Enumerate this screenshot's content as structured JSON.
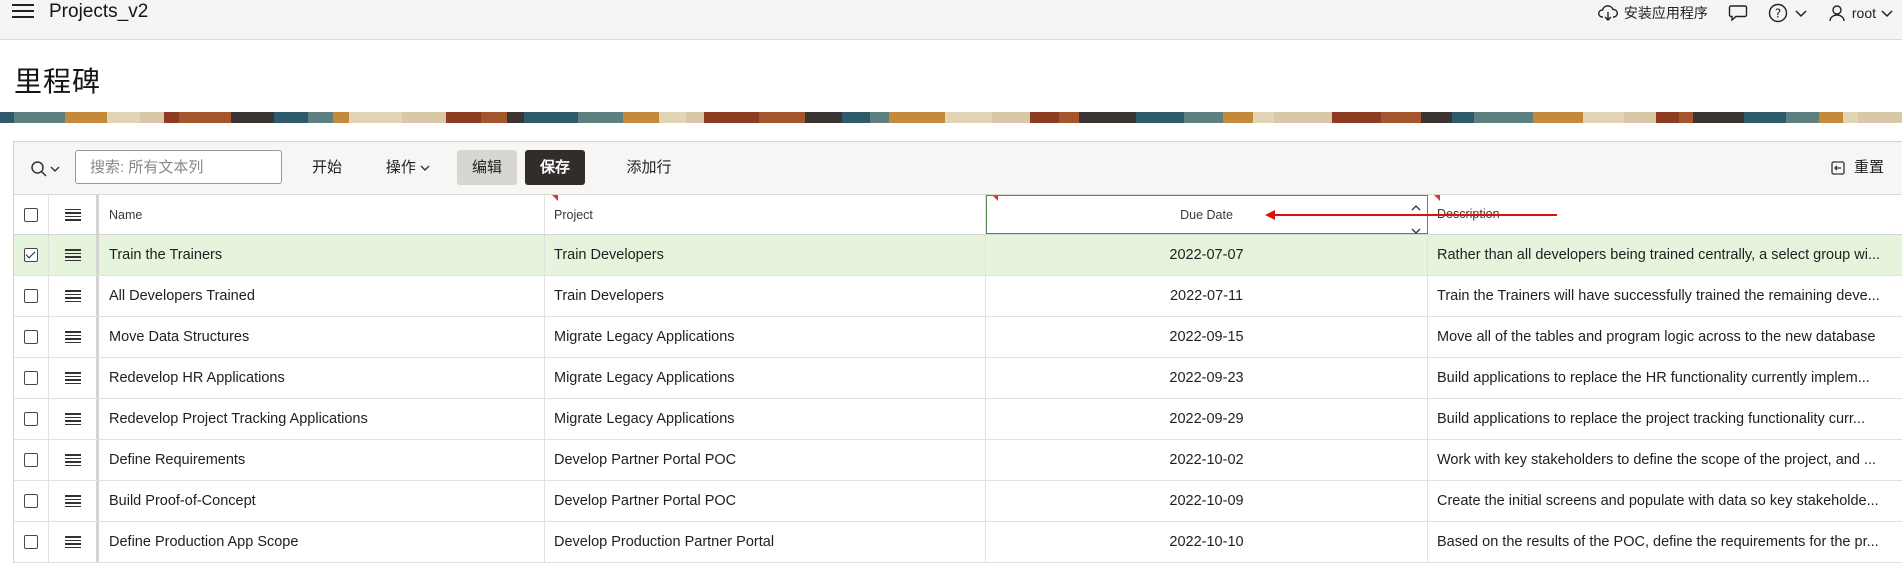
{
  "header": {
    "app_title": "Projects_v2",
    "install_label": "安装应用程序",
    "user_label": "root"
  },
  "page": {
    "title": "里程碑"
  },
  "toolbar": {
    "search_placeholder": "搜索: 所有文本列",
    "go_label": "开始",
    "actions_label": "操作",
    "edit_label": "编辑",
    "save_label": "保存",
    "add_row_label": "添加行",
    "reset_label": "重置"
  },
  "grid": {
    "columns": {
      "name": "Name",
      "project": "Project",
      "due_date": "Due Date",
      "description": "Description"
    },
    "rows": [
      {
        "name": "Train the Trainers",
        "project": "Train Developers",
        "due_date": "2022-07-07",
        "description": "Rather than all developers being trained centrally, a select group wi..."
      },
      {
        "name": "All Developers Trained",
        "project": "Train Developers",
        "due_date": "2022-07-11",
        "description": "Train the Trainers will have successfully trained the remaining deve..."
      },
      {
        "name": "Move Data Structures",
        "project": "Migrate Legacy Applications",
        "due_date": "2022-09-15",
        "description": "Move all of the tables and program logic across to the new database"
      },
      {
        "name": "Redevelop HR Applications",
        "project": "Migrate Legacy Applications",
        "due_date": "2022-09-23",
        "description": "Build applications to replace the HR functionality currently implem..."
      },
      {
        "name": "Redevelop Project Tracking Applications",
        "project": "Migrate Legacy Applications",
        "due_date": "2022-09-29",
        "description": "Build applications to replace the project tracking functionality curr..."
      },
      {
        "name": "Define Requirements",
        "project": "Develop Partner Portal POC",
        "due_date": "2022-10-02",
        "description": "Work with key stakeholders to define the scope of the project, and ..."
      },
      {
        "name": "Build Proof-of-Concept",
        "project": "Develop Partner Portal POC",
        "due_date": "2022-10-09",
        "description": "Create the initial screens and populate with data so key stakeholde..."
      },
      {
        "name": "Define Production App Scope",
        "project": "Develop Production Partner Portal",
        "due_date": "2022-10-10",
        "description": "Based on the results of the POC, define the requirements for the pr..."
      }
    ],
    "selected_row": 0
  },
  "colors": {
    "save_bg": "#312d2a",
    "selected_row_bg": "#e6f4de",
    "annotation_arrow": "#dd1111"
  }
}
